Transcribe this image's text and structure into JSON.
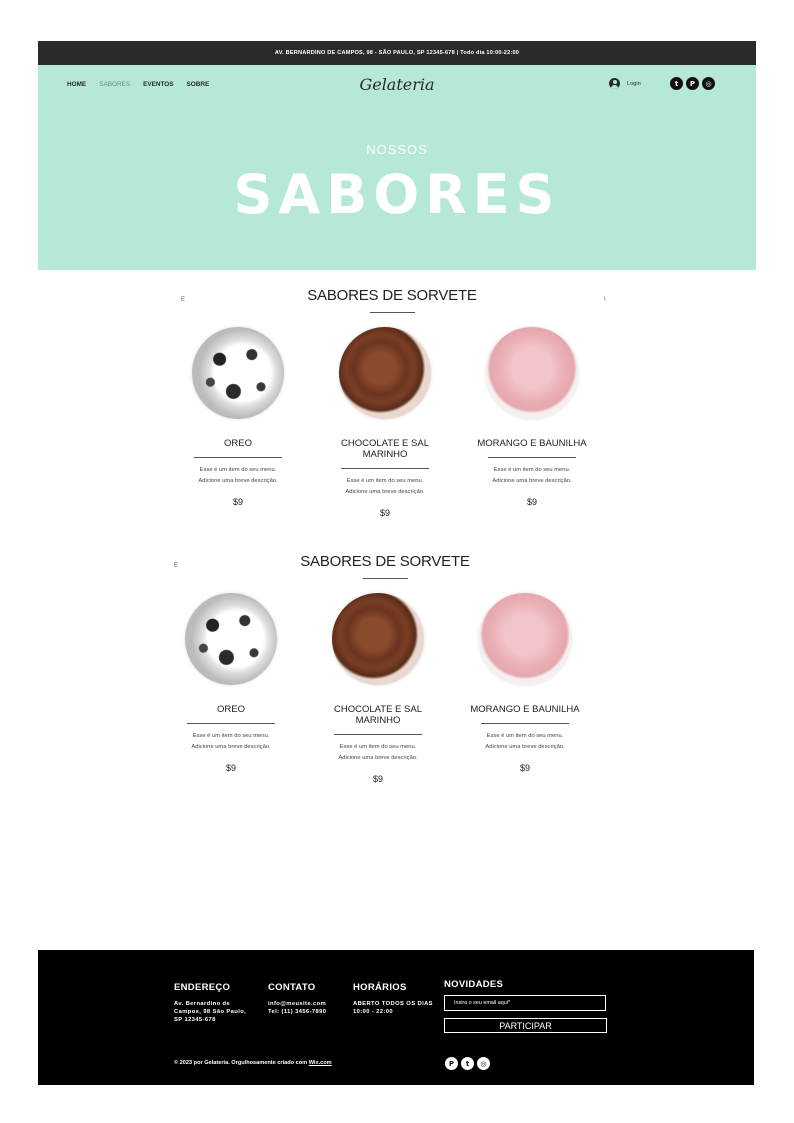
{
  "topbar": {
    "text": "AV. BERNARDINO DE CAMPOS, 98 - SÃO PAULO, SP 12345-678  |  Todo dia 10:00-22:00"
  },
  "nav": {
    "items": [
      "HOME",
      "SABORES",
      "EVENTOS",
      "SOBRE"
    ],
    "active": "SABORES"
  },
  "brand": {
    "logo": "Gelateria"
  },
  "account": {
    "login_label": "Login"
  },
  "social": {
    "icons": [
      "twitter-icon",
      "pinterest-icon",
      "instagram-icon"
    ]
  },
  "hero": {
    "subtitle": "NOSSOS",
    "title": "SABORES",
    "background": "#b5e8d5"
  },
  "menus": [
    {
      "title": "SABORES DE SORVETE",
      "stray_left": "E",
      "stray_right": "I",
      "items": [
        {
          "name": "OREO",
          "description": "Esse é um item do seu menu. Adicione uma breve descrição.",
          "price": "$9"
        },
        {
          "name": "CHOCOLATE E SAL MARINHO",
          "description": "Esse é um item do seu menu. Adicione uma breve descrição.",
          "price": "$9"
        },
        {
          "name": "MORANGO E BAUNILHA",
          "description": "Esse é um item do seu menu. Adicione uma breve descrição.",
          "price": "$9"
        }
      ]
    },
    {
      "title": "SABORES DE SORVETE",
      "stray_left": "E",
      "stray_right": "",
      "items": [
        {
          "name": "OREO",
          "description": "Esse é um item do seu menu. Adicione uma breve descrição.",
          "price": "$9"
        },
        {
          "name": "CHOCOLATE E SAL MARINHO",
          "description": "Esse é um item do seu menu. Adicione uma breve descrição.",
          "price": "$9"
        },
        {
          "name": "MORANGO E BAUNILHA",
          "description": "Esse é um item do seu menu. Adicione uma breve descrição.",
          "price": "$9"
        }
      ]
    }
  ],
  "footer": {
    "address": {
      "heading": "ENDEREÇO",
      "lines": [
        "Av. Bernardino de",
        "Campos, 98 São Paulo,",
        "SP 12345-678"
      ]
    },
    "contact": {
      "heading": "CONTATO",
      "lines": [
        "info@meusite.com",
        "Tel: (11) 3456-7890"
      ]
    },
    "hours": {
      "heading": "HORÁRIOS",
      "lines": [
        "ABERTO TODOS OS DIAS",
        "10:00 - 22:00"
      ]
    },
    "newsletter": {
      "heading": "NOVIDADES",
      "placeholder": "Insira o seu email aqui*",
      "button": "PARTICIPAR"
    },
    "copyright_prefix": "© 2023 por Gelateria. Orgulhosamente criado com ",
    "copyright_link": "Wix.com",
    "social_icons": [
      "pinterest-icon",
      "twitter-icon",
      "instagram-icon"
    ]
  }
}
